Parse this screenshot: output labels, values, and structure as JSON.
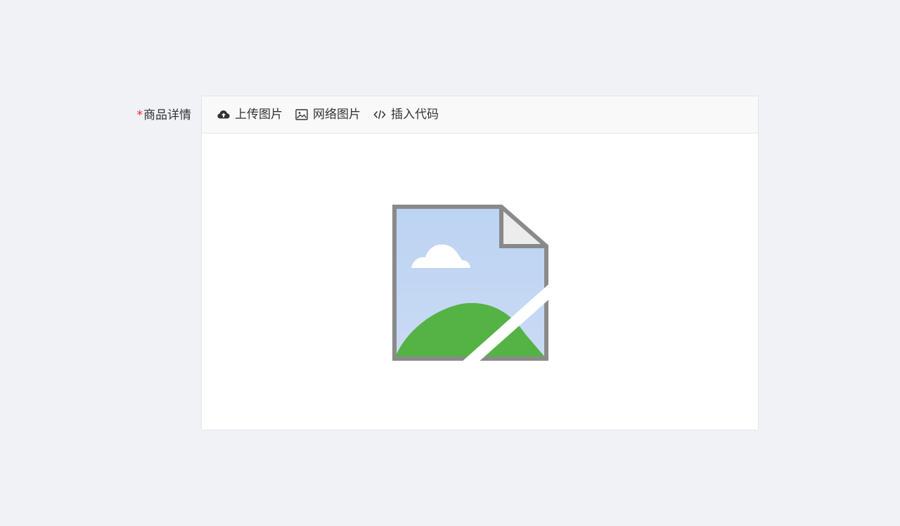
{
  "form": {
    "required_mark": "*",
    "label": "商品详情"
  },
  "toolbar": {
    "upload_image": "上传图片",
    "network_image": "网络图片",
    "insert_code": "插入代码"
  },
  "icons": {
    "upload": "cloud-upload-icon",
    "image": "image-icon",
    "code": "code-icon",
    "broken_image": "broken-image-icon"
  },
  "colors": {
    "required": "#f5222d",
    "background": "#f0f2f5",
    "toolbar_bg": "#f9f9f9",
    "border": "#e3e5e8"
  }
}
